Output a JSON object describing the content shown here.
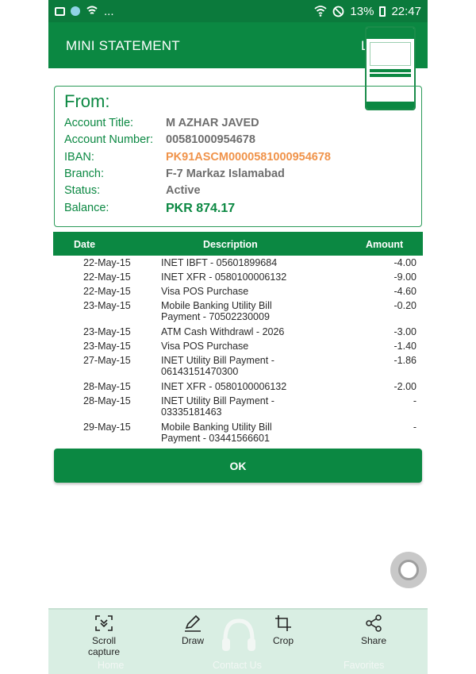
{
  "status_bar": {
    "dots": "...",
    "battery": "13%",
    "time": "22:47"
  },
  "app_bar": {
    "title": "MINI STATEMENT",
    "partial_letter": "L"
  },
  "from": {
    "heading": "From:",
    "fields": [
      {
        "label": "Account Title:",
        "value": "M AZHAR JAVED"
      },
      {
        "label": "Account Number:",
        "value": "00581000954678"
      },
      {
        "label": "IBAN:",
        "value": "PK91ASCM0000581000954678"
      },
      {
        "label": "Branch:",
        "value": "F-7 Markaz Islamabad"
      },
      {
        "label": "Status:",
        "value": "Active"
      },
      {
        "label": "Balance:",
        "value": "PKR 874.17"
      }
    ]
  },
  "table": {
    "headers": {
      "date": "Date",
      "description": "Description",
      "amount": "Amount"
    },
    "rows": [
      {
        "date": "22-May-15",
        "desc1": "INET IBFT - 05601899684",
        "desc2": "",
        "amount": "-4.00"
      },
      {
        "date": "22-May-15",
        "desc1": "INET XFR - 0580100006132",
        "desc2": "",
        "amount": "-9.00"
      },
      {
        "date": "22-May-15",
        "desc1": "Visa POS Purchase",
        "desc2": "",
        "amount": "-4.60"
      },
      {
        "date": "23-May-15",
        "desc1": "Mobile Banking Utility Bill",
        "desc2": "Payment - 70502230009",
        "amount": "-0.20"
      },
      {
        "date": "23-May-15",
        "desc1": "ATM Cash Withdrawl - 2026",
        "desc2": "",
        "amount": "-3.00"
      },
      {
        "date": "23-May-15",
        "desc1": "Visa POS Purchase",
        "desc2": "",
        "amount": "-1.40"
      },
      {
        "date": "27-May-15",
        "desc1": "INET Utility Bill Payment -",
        "desc2": "06143151470300",
        "amount": "-1.86"
      },
      {
        "date": "28-May-15",
        "desc1": "INET XFR - 0580100006132",
        "desc2": "",
        "amount": "-2.00"
      },
      {
        "date": "28-May-15",
        "desc1": "INET Utility Bill Payment -",
        "desc2": "03335181463",
        "amount": "-"
      },
      {
        "date": "29-May-15",
        "desc1": "Mobile Banking Utility Bill",
        "desc2": "Payment - 03441566601",
        "amount": "-"
      }
    ]
  },
  "ok_label": "OK",
  "toolbar": {
    "scroll_line1": "Scroll",
    "scroll_line2": "capture",
    "draw": "Draw",
    "crop": "Crop",
    "share": "Share"
  },
  "ghost_nav": {
    "home": "Home",
    "contact": "Contact Us",
    "favorites": "Favorites"
  },
  "colors": {
    "primary": "#0b8842",
    "iban": "#f0934a",
    "value_gray": "#6e6e6e"
  }
}
